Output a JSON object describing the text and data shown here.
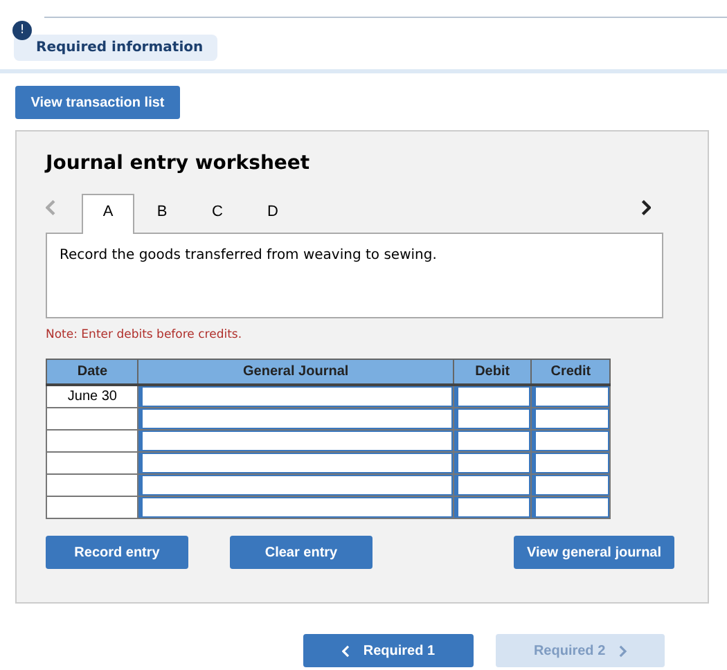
{
  "requirement_tab": {
    "badge": "!",
    "label": "Required information"
  },
  "view_transaction_button": "View transaction list",
  "worksheet": {
    "title": "Journal entry worksheet",
    "tabs": [
      {
        "label": "A",
        "selected": true
      },
      {
        "label": "B",
        "selected": false
      },
      {
        "label": "C",
        "selected": false
      },
      {
        "label": "D",
        "selected": false
      }
    ],
    "prev_disabled": true,
    "instruction": "Record the goods transferred from weaving to sewing.",
    "note": "Note: Enter debits before credits.",
    "table": {
      "columns": [
        "Date",
        "General Journal",
        "Debit",
        "Credit"
      ],
      "rows": [
        {
          "date": "June 30"
        },
        {
          "date": ""
        },
        {
          "date": ""
        },
        {
          "date": ""
        },
        {
          "date": ""
        },
        {
          "date": ""
        }
      ]
    },
    "buttons": [
      "Record entry",
      "Clear entry",
      "View general journal"
    ]
  },
  "navigation": [
    {
      "label": "Required 1",
      "kind": "back",
      "disabled": false
    },
    {
      "label": "Required 2",
      "kind": "forward",
      "disabled": true
    }
  ]
}
